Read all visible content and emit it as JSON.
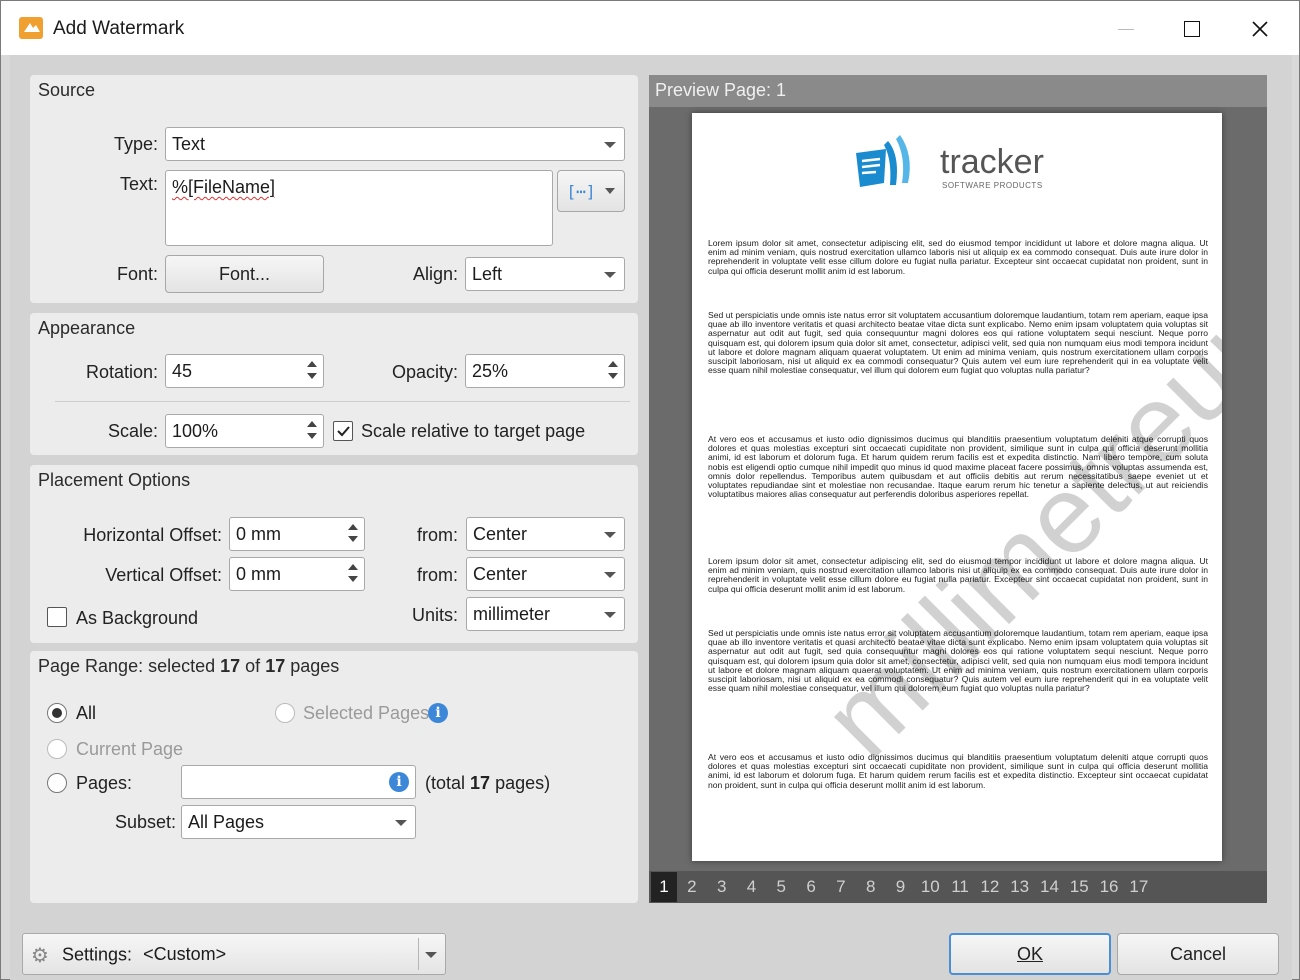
{
  "window": {
    "title": "Add Watermark"
  },
  "source": {
    "title": "Source",
    "type_label": "Type:",
    "type_value": "Text",
    "text_label": "Text:",
    "text_value": "%[FileName]",
    "font_label": "Font:",
    "font_button": "Font...",
    "align_label": "Align:",
    "align_value": "Left"
  },
  "appearance": {
    "title": "Appearance",
    "rotation_label": "Rotation:",
    "rotation_value": "45",
    "opacity_label": "Opacity:",
    "opacity_value": "25%",
    "scale_label": "Scale:",
    "scale_value": "100%",
    "scale_relative_label": "Scale relative to target page",
    "scale_relative_checked": true
  },
  "placement": {
    "title": "Placement Options",
    "h_offset_label": "Horizontal Offset:",
    "h_offset_value": "0 mm",
    "v_offset_label": "Vertical Offset:",
    "v_offset_value": "0 mm",
    "from_label": "from:",
    "h_from_value": "Center",
    "v_from_value": "Center",
    "as_background_label": "As Background",
    "units_label": "Units:",
    "units_value": "millimeter"
  },
  "page_range": {
    "title_prefix": "Page Range: selected ",
    "selected": "17",
    "of": " of ",
    "total": "17",
    "title_suffix": " pages",
    "all_label": "All",
    "selected_pages_label": "Selected Pages",
    "current_page_label": "Current Page",
    "pages_label": "Pages:",
    "pages_value": "",
    "total_note_prefix": "(total ",
    "total_note_count": "17",
    "total_note_suffix": " pages)",
    "subset_label": "Subset:",
    "subset_value": "All Pages"
  },
  "preview": {
    "title": "Preview Page: 1",
    "logo_text": "tracker",
    "logo_sub": "SOFTWARE PRODUCTS",
    "watermark_text": "millimetreum",
    "pages": [
      "1",
      "2",
      "3",
      "4",
      "5",
      "6",
      "7",
      "8",
      "9",
      "10",
      "11",
      "12",
      "13",
      "14",
      "15",
      "16",
      "17"
    ],
    "current_page": "1",
    "paragraphs": [
      "Lorem ipsum dolor sit amet, consectetur adipiscing elit, sed do eiusmod tempor incididunt ut labore et dolore magna aliqua. Ut enim ad minim veniam, quis nostrud exercitation ullamco laboris nisi ut aliquip ex ea commodo consequat. Duis aute irure dolor in reprehenderit in voluptate velit esse cillum dolore eu fugiat nulla pariatur. Excepteur sint occaecat cupidatat non proident, sunt in culpa qui officia deserunt mollit anim id est laborum.",
      "Sed ut perspiciatis unde omnis iste natus error sit voluptatem accusantium doloremque laudantium, totam rem aperiam, eaque ipsa quae ab illo inventore veritatis et quasi architecto beatae vitae dicta sunt explicabo. Nemo enim ipsam voluptatem quia voluptas sit aspernatur aut odit aut fugit, sed quia consequuntur magni dolores eos qui ratione voluptatem sequi nesciunt. Neque porro quisquam est, qui dolorem ipsum quia dolor sit amet, consectetur, adipisci velit, sed quia non numquam eius modi tempora incidunt ut labore et dolore magnam aliquam quaerat voluptatem. Ut enim ad minima veniam, quis nostrum exercitationem ullam corporis suscipit laboriosam, nisi ut aliquid ex ea commodi consequatur? Quis autem vel eum iure reprehenderit qui in ea voluptate velit esse quam nihil molestiae consequatur, vel illum qui dolorem eum fugiat quo voluptas nulla pariatur?",
      "At vero eos et accusamus et iusto odio dignissimos ducimus qui blanditiis praesentium voluptatum deleniti atque corrupti quos dolores et quas molestias excepturi sint occaecati cupiditate non provident, similique sunt in culpa qui officia deserunt mollitia animi, id est laborum et dolorum fuga. Et harum quidem rerum facilis est et expedita distinctio. Nam libero tempore, cum soluta nobis est eligendi optio cumque nihil impedit quo minus id quod maxime placeat facere possimus, omnis voluptas assumenda est, omnis dolor repellendus. Temporibus autem quibusdam et aut officiis debitis aut rerum necessitatibus saepe eveniet ut et voluptates repudiandae sint et molestiae non recusandae. Itaque earum rerum hic tenetur a sapiente delectus, ut aut reiciendis voluptatibus maiores alias consequatur aut perferendis doloribus asperiores repellat.",
      "Lorem ipsum dolor sit amet, consectetur adipiscing elit, sed do eiusmod tempor incididunt ut labore et dolore magna aliqua. Ut enim ad minim veniam, quis nostrud exercitation ullamco laboris nisi ut aliquip ex ea commodo consequat. Duis aute irure dolor in reprehenderit in voluptate velit esse cillum dolore eu fugiat nulla pariatur. Excepteur sint occaecat cupidatat non proident, sunt in culpa qui officia deserunt mollit anim id est laborum.",
      "Sed ut perspiciatis unde omnis iste natus error sit voluptatem accusantium doloremque laudantium, totam rem aperiam, eaque ipsa quae ab illo inventore veritatis et quasi architecto beatae vitae dicta sunt explicabo. Nemo enim ipsam voluptatem quia voluptas sit aspernatur aut odit aut fugit, sed quia consequuntur magni dolores eos qui ratione voluptatem sequi nesciunt. Neque porro quisquam est, qui dolorem ipsum quia dolor sit amet, consectetur, adipisci velit, sed quia non numquam eius modi tempora incidunt ut labore et dolore magnam aliquam quaerat voluptatem. Ut enim ad minima veniam, quis nostrum exercitationem ullam corporis suscipit laboriosam, nisi ut aliquid ex ea commodi consequatur? Quis autem vel eum iure reprehenderit qui in ea voluptate velit esse quam nihil molestiae consequatur, vel illum qui dolorem eum fugiat quo voluptas nulla pariatur?",
      "At vero eos et accusamus et iusto odio dignissimos ducimus qui blanditiis praesentium voluptatum deleniti atque corrupti quos dolores et quas molestias excepturi sint occaecati cupiditate non provident, similique sunt in culpa qui officia deserunt mollitia animi, id est laborum et dolorum fuga. Et harum quidem rerum facilis est et expedita distinctio. Excepteur sint occaecat cupidatat non proident, sunt in culpa qui officia deserunt mollit anim id est laborum."
    ]
  },
  "footer": {
    "settings_label": "Settings:",
    "settings_value": "<Custom>",
    "ok_label": "OK",
    "cancel_label": "Cancel"
  },
  "colors": {
    "accent": "#3d87d8",
    "icon_orange": "#f0a030"
  }
}
